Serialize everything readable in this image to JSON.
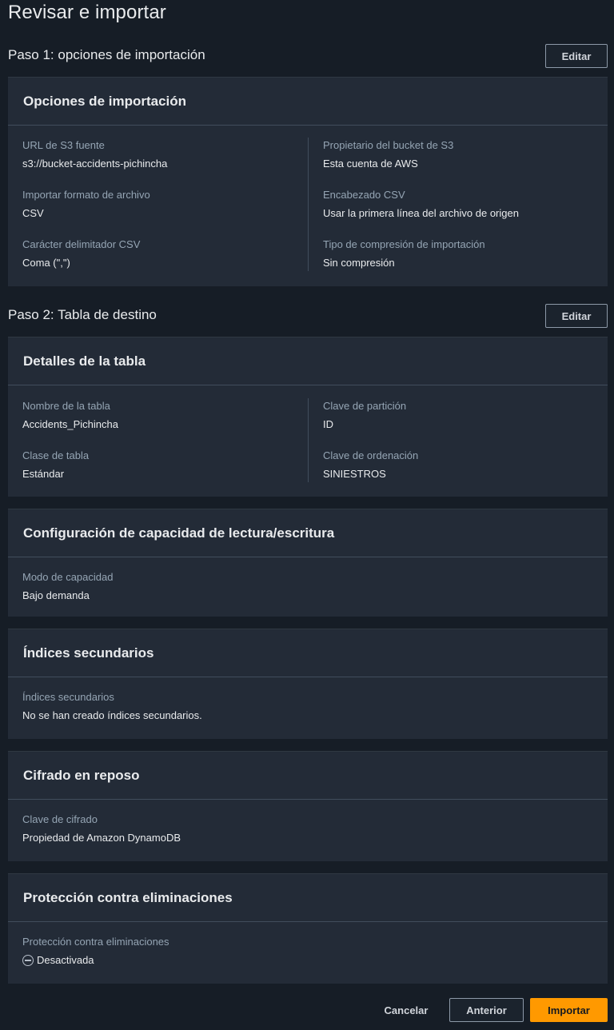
{
  "page": {
    "title": "Revisar e importar"
  },
  "step1": {
    "title": "Paso 1: opciones de importación",
    "edit_label": "Editar",
    "card_title": "Opciones de importación",
    "fields": {
      "s3_url": {
        "label": "URL de S3 fuente",
        "value": "s3://bucket-accidents-pichincha"
      },
      "bucket_owner": {
        "label": "Propietario del bucket de S3",
        "value": "Esta cuenta de AWS"
      },
      "file_format": {
        "label": "Importar formato de archivo",
        "value": "CSV"
      },
      "csv_header": {
        "label": "Encabezado CSV",
        "value": "Usar la primera línea del archivo de origen"
      },
      "delimiter": {
        "label": "Carácter delimitador CSV",
        "value": "Coma (\",\")"
      },
      "compression": {
        "label": "Tipo de compresión de importación",
        "value": "Sin compresión"
      }
    }
  },
  "step2": {
    "title": "Paso 2: Tabla de destino",
    "edit_label": "Editar",
    "table_details": {
      "card_title": "Detalles de la tabla",
      "table_name": {
        "label": "Nombre de la tabla",
        "value": "Accidents_Pichincha"
      },
      "partition_key": {
        "label": "Clave de partición",
        "value": "ID"
      },
      "table_class": {
        "label": "Clase de tabla",
        "value": "Estándar"
      },
      "sort_key": {
        "label": "Clave de ordenación",
        "value": "SINIESTROS"
      }
    },
    "capacity": {
      "card_title": "Configuración de capacidad de lectura/escritura",
      "mode": {
        "label": "Modo de capacidad",
        "value": "Bajo demanda"
      }
    },
    "secondary_indexes": {
      "card_title": "Índices secundarios",
      "indexes": {
        "label": "Índices secundarios",
        "value": "No se han creado índices secundarios."
      }
    },
    "encryption": {
      "card_title": "Cifrado en reposo",
      "key": {
        "label": "Clave de cifrado",
        "value": "Propiedad de Amazon DynamoDB"
      }
    },
    "deletion_protection": {
      "card_title": "Protección contra eliminaciones",
      "status": {
        "label": "Protección contra eliminaciones",
        "value": "Desactivada",
        "icon": "minus-circle-icon"
      }
    }
  },
  "footer": {
    "cancel_label": "Cancelar",
    "previous_label": "Anterior",
    "import_label": "Importar"
  },
  "colors": {
    "primary": "#ff9900",
    "background": "#161d26",
    "card": "#232b37"
  }
}
